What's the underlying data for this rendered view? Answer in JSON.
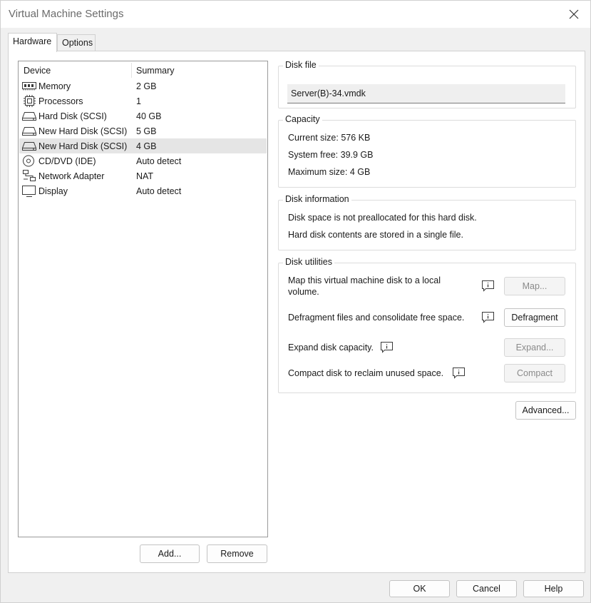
{
  "window": {
    "title": "Virtual Machine Settings"
  },
  "tabs": [
    {
      "label": "Hardware",
      "active": true
    },
    {
      "label": "Options",
      "active": false
    }
  ],
  "devices": {
    "headers": [
      "Device",
      "Summary"
    ],
    "rows": [
      {
        "icon": "memory-icon",
        "name": "Memory",
        "summary": "2 GB"
      },
      {
        "icon": "processor-icon",
        "name": "Processors",
        "summary": "1"
      },
      {
        "icon": "hard-disk-icon",
        "name": "Hard Disk (SCSI)",
        "summary": "40 GB"
      },
      {
        "icon": "hard-disk-icon",
        "name": "New Hard Disk (SCSI)",
        "summary": "5 GB"
      },
      {
        "icon": "hard-disk-icon",
        "name": "New Hard Disk (SCSI)",
        "summary": "4 GB",
        "selected": true
      },
      {
        "icon": "cd-dvd-icon",
        "name": "CD/DVD (IDE)",
        "summary": "Auto detect"
      },
      {
        "icon": "network-adapter-icon",
        "name": "Network Adapter",
        "summary": "NAT"
      },
      {
        "icon": "display-icon",
        "name": "Display",
        "summary": "Auto detect"
      }
    ]
  },
  "list_buttons": {
    "add": "Add...",
    "remove": "Remove"
  },
  "disk_file": {
    "legend": "Disk file",
    "value": "Server(B)-34.vmdk"
  },
  "capacity": {
    "legend": "Capacity",
    "current_size": "Current size:  576 KB",
    "system_free": "System free:  39.9 GB",
    "maximum_size": "Maximum size:  4 GB"
  },
  "disk_information": {
    "legend": "Disk information",
    "line1": "Disk space is not preallocated for this hard disk.",
    "line2": "Hard disk contents are stored in a single file."
  },
  "disk_utilities": {
    "legend": "Disk utilities",
    "map_text_1": "Map this virtual machine disk to a local",
    "map_text_2": "volume.",
    "map_button": "Map...",
    "defrag_text": "Defragment files and consolidate free space.",
    "defrag_button": "Defragment",
    "expand_text": "Expand disk capacity.",
    "expand_button": "Expand...",
    "compact_text": "Compact disk to reclaim unused space.",
    "compact_button": "Compact"
  },
  "advanced_button": "Advanced...",
  "footer": {
    "ok": "OK",
    "cancel": "Cancel",
    "help": "Help"
  },
  "colors": {
    "selection": "#e5e5e5",
    "icon_stroke": "#3a3a3a",
    "disabled_text": "#8a8a8a"
  }
}
